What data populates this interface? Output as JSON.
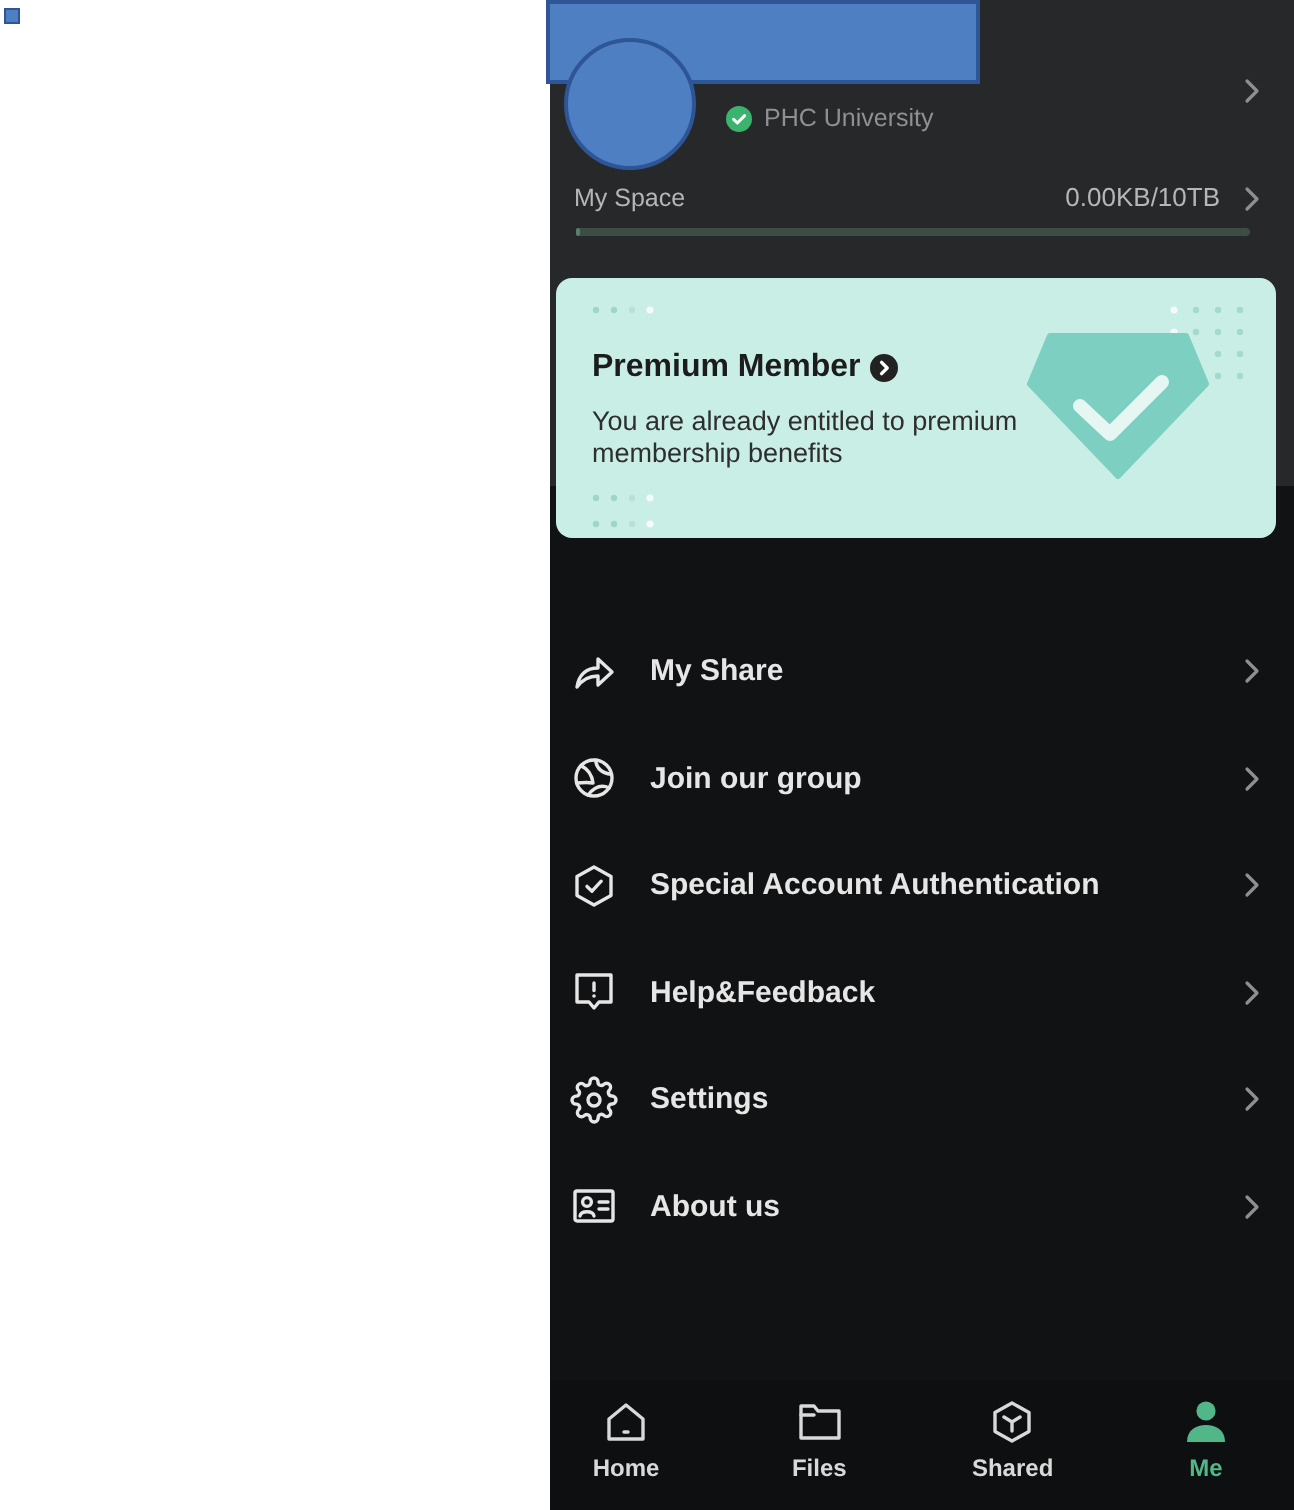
{
  "profile": {
    "organization": "PHC University",
    "verified": true
  },
  "storage": {
    "label": "My Space",
    "usage": "0.00KB/10TB",
    "level": 0
  },
  "premium_card": {
    "title": "Premium Member",
    "description": "You are already entitled to premium membership benefits"
  },
  "menu": [
    {
      "label": "My Share"
    },
    {
      "label": "Join our group"
    },
    {
      "label": "Special Account Authentication"
    },
    {
      "label": "Help&Feedback"
    },
    {
      "label": "Settings"
    },
    {
      "label": "About us"
    }
  ],
  "tab_bar": [
    {
      "label": "Home",
      "selected": false
    },
    {
      "label": "Files",
      "selected": false
    },
    {
      "label": "Shared",
      "selected": false
    },
    {
      "label": "Me",
      "selected": true
    }
  ]
}
